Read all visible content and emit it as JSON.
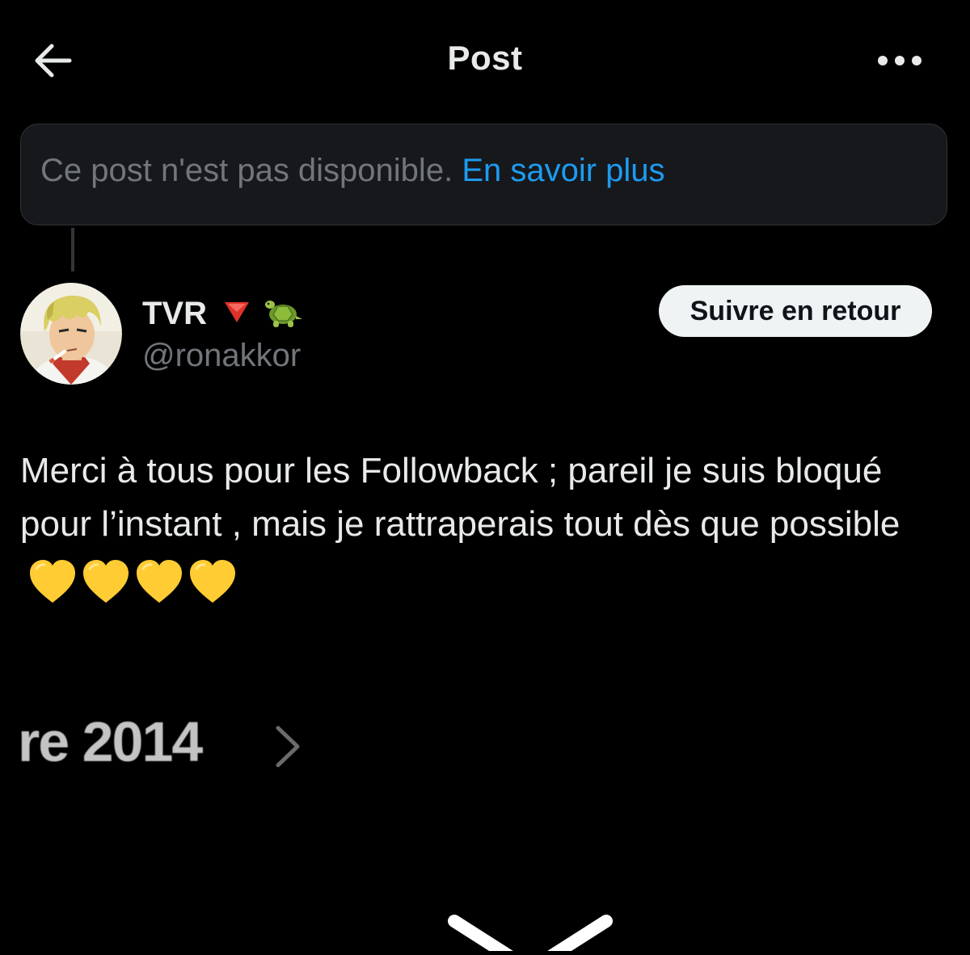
{
  "header": {
    "title": "Post"
  },
  "notice": {
    "text": "Ce post n'est pas disponible.",
    "link": "En savoir plus"
  },
  "author": {
    "name": "TVR",
    "name_emojis": [
      "red-triangle-down",
      "turtle"
    ],
    "handle": "@ronakkor",
    "follow_button": "Suivre en retour"
  },
  "post": {
    "text": "Merci à tous pour les Followback ; pareil je suis bloqué pour l’instant , mais je rattraperais tout dès que possible",
    "emojis": [
      "yellow-heart",
      "yellow-heart",
      "yellow-heart",
      "yellow-heart"
    ]
  },
  "background_fragment": {
    "text": "re 2014"
  },
  "colors": {
    "background": "#000000",
    "text_primary": "#e7e9ea",
    "text_secondary": "#71767b",
    "link": "#1d9bf0",
    "notice_bg": "#16181c",
    "button_bg": "#eff3f4",
    "heart": "#ffcc33"
  },
  "icons": {
    "back": "arrow-left-icon",
    "more": "more-horizontal-icon",
    "partial_chevron": "chevron-right-icon",
    "bottom_chevron": "chevron-down-icon"
  }
}
